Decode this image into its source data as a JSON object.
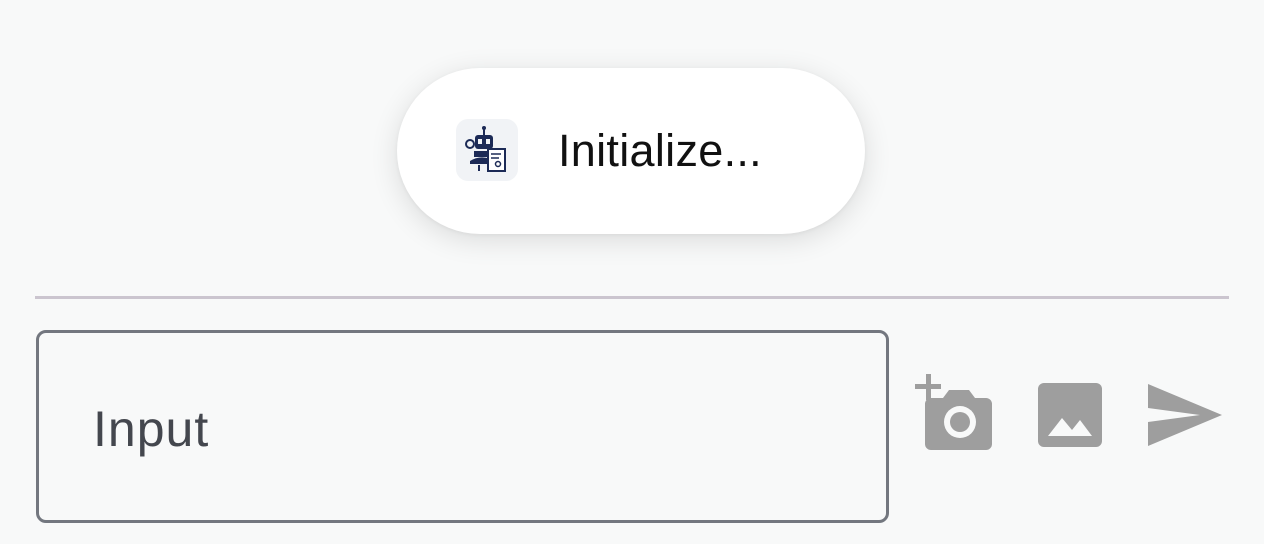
{
  "toast": {
    "message": "Initialize...",
    "icon": "robot-assistant-icon"
  },
  "input": {
    "placeholder": "Input"
  },
  "actions": {
    "camera_icon": "add-photo-camera-icon",
    "gallery_icon": "image-gallery-icon",
    "send_icon": "send-icon"
  },
  "colors": {
    "background": "#f8f9f9",
    "icon_gray": "#9e9e9e",
    "border": "#73777f",
    "divider": "#cbc5cf",
    "robot_navy": "#1c2a56"
  }
}
